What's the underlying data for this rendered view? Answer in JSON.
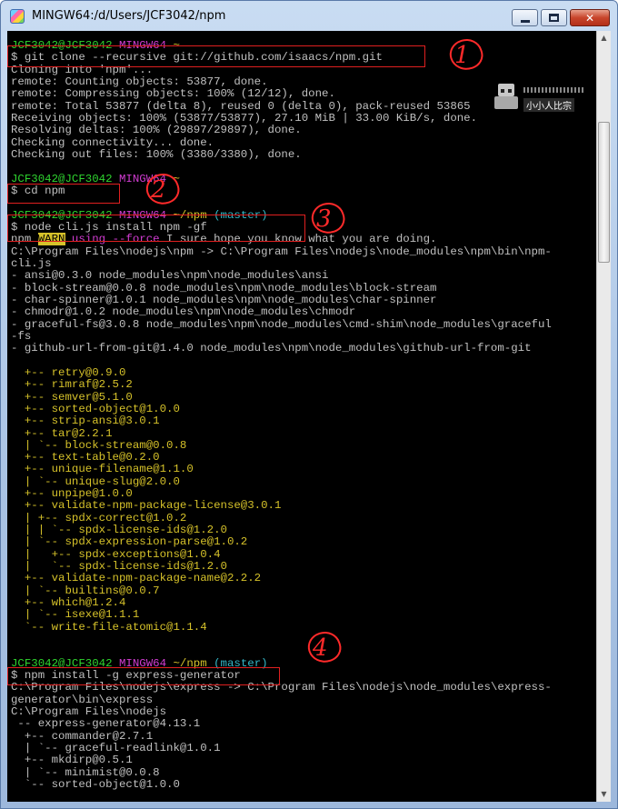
{
  "window": {
    "title": "MINGW64:/d/Users/JCF3042/npm",
    "controls": {
      "minimize": "minimize-button",
      "maximize": "maximize-button",
      "close": "close-button"
    }
  },
  "watermark": {
    "text": "小小人比宗"
  },
  "annotations": [
    "1",
    "2",
    "3",
    "4"
  ],
  "terminal": {
    "lines": [
      [
        [
          "JCF3042@JCF3042 ",
          "user"
        ],
        [
          "MINGW64 ",
          "host"
        ],
        [
          "~",
          "path"
        ]
      ],
      [
        [
          "$ git clone --recursive git://github.com/isaacs/npm.git",
          ""
        ]
      ],
      [
        [
          "Cloning into 'npm'...",
          ""
        ]
      ],
      [
        [
          "remote: Counting objects: 53877, done.",
          ""
        ]
      ],
      [
        [
          "remote: Compressing objects: 100% (12/12), done.",
          ""
        ]
      ],
      [
        [
          "remote: Total 53877 (delta 8), reused 0 (delta 0), pack-reused 53865",
          ""
        ]
      ],
      [
        [
          "Receiving objects: 100% (53877/53877), 27.10 MiB | 33.00 KiB/s, done.",
          ""
        ]
      ],
      [
        [
          "Resolving deltas: 100% (29897/29897), done.",
          ""
        ]
      ],
      [
        [
          "Checking connectivity... done.",
          ""
        ]
      ],
      [
        [
          "Checking out files: 100% (3380/3380), done.",
          ""
        ]
      ],
      [
        [
          "",
          ""
        ]
      ],
      [
        [
          "JCF3042@JCF3042 ",
          "user"
        ],
        [
          "MINGW64 ",
          "host"
        ],
        [
          "~",
          "path"
        ]
      ],
      [
        [
          "$ cd npm",
          ""
        ]
      ],
      [
        [
          "",
          ""
        ]
      ],
      [
        [
          "JCF3042@JCF3042 ",
          "user"
        ],
        [
          "MINGW64 ",
          "host"
        ],
        [
          "~/npm ",
          "path"
        ],
        [
          "(master)",
          "branch"
        ]
      ],
      [
        [
          "$ node cli.js install npm -gf",
          ""
        ]
      ],
      [
        [
          "npm ",
          ""
        ],
        [
          "WARN",
          "warn"
        ],
        [
          " using ",
          "force"
        ],
        [
          "--force",
          "force"
        ],
        [
          " I sure hope you know what you are doing.",
          ""
        ]
      ],
      [
        [
          "C:\\Program Files\\nodejs\\npm -> C:\\Program Files\\nodejs\\node_modules\\npm\\bin\\npm-",
          ""
        ]
      ],
      [
        [
          "cli.js",
          ""
        ]
      ],
      [
        [
          "- ansi@0.3.0 node_modules\\npm\\node_modules\\ansi",
          ""
        ]
      ],
      [
        [
          "- block-stream@0.0.8 node_modules\\npm\\node_modules\\block-stream",
          ""
        ]
      ],
      [
        [
          "- char-spinner@1.0.1 node_modules\\npm\\node_modules\\char-spinner",
          ""
        ]
      ],
      [
        [
          "- chmodr@1.0.2 node_modules\\npm\\node_modules\\chmodr",
          ""
        ]
      ],
      [
        [
          "- graceful-fs@3.0.8 node_modules\\npm\\node_modules\\cmd-shim\\node_modules\\graceful",
          ""
        ]
      ],
      [
        [
          "-fs",
          ""
        ]
      ],
      [
        [
          "- github-url-from-git@1.4.0 node_modules\\npm\\node_modules\\github-url-from-git",
          ""
        ]
      ],
      [
        [
          "",
          ""
        ]
      ],
      [
        [
          "  +-- retry@0.9.0",
          "tree"
        ]
      ],
      [
        [
          "  +-- rimraf@2.5.2",
          "tree"
        ]
      ],
      [
        [
          "  +-- semver@5.1.0",
          "tree"
        ]
      ],
      [
        [
          "  +-- sorted-object@1.0.0",
          "tree"
        ]
      ],
      [
        [
          "  +-- strip-ansi@3.0.1",
          "tree"
        ]
      ],
      [
        [
          "  +-- tar@2.2.1",
          "tree"
        ]
      ],
      [
        [
          "  | `-- block-stream@0.0.8",
          "tree"
        ]
      ],
      [
        [
          "  +-- text-table@0.2.0",
          "tree"
        ]
      ],
      [
        [
          "  +-- unique-filename@1.1.0",
          "tree"
        ]
      ],
      [
        [
          "  | `-- unique-slug@2.0.0",
          "tree"
        ]
      ],
      [
        [
          "  +-- unpipe@1.0.0",
          "tree"
        ]
      ],
      [
        [
          "  +-- validate-npm-package-license@3.0.1",
          "tree"
        ]
      ],
      [
        [
          "  | +-- spdx-correct@1.0.2",
          "tree"
        ]
      ],
      [
        [
          "  | | `-- spdx-license-ids@1.2.0",
          "tree"
        ]
      ],
      [
        [
          "  | `-- spdx-expression-parse@1.0.2",
          "tree"
        ]
      ],
      [
        [
          "  |   +-- spdx-exceptions@1.0.4",
          "tree"
        ]
      ],
      [
        [
          "  |   `-- spdx-license-ids@1.2.0",
          "tree"
        ]
      ],
      [
        [
          "  +-- validate-npm-package-name@2.2.2",
          "tree"
        ]
      ],
      [
        [
          "  | `-- builtins@0.0.7",
          "tree"
        ]
      ],
      [
        [
          "  +-- which@1.2.4",
          "tree"
        ]
      ],
      [
        [
          "  | `-- isexe@1.1.1",
          "tree"
        ]
      ],
      [
        [
          "  `-- write-file-atomic@1.1.4",
          "tree"
        ]
      ],
      [
        [
          "",
          ""
        ]
      ],
      [
        [
          "",
          ""
        ]
      ],
      [
        [
          "JCF3042@JCF3042 ",
          "user"
        ],
        [
          "MINGW64 ",
          "host"
        ],
        [
          "~/npm ",
          "path"
        ],
        [
          "(master)",
          "branch"
        ]
      ],
      [
        [
          "$ npm install -g express-generator",
          ""
        ]
      ],
      [
        [
          "C:\\Program Files\\nodejs\\express -> C:\\Program Files\\nodejs\\node_modules\\express-",
          ""
        ]
      ],
      [
        [
          "generator\\bin\\express",
          ""
        ]
      ],
      [
        [
          "C:\\Program Files\\nodejs",
          ""
        ]
      ],
      [
        [
          " -- express-generator@4.13.1",
          ""
        ]
      ],
      [
        [
          "  +-- commander@2.7.1",
          ""
        ]
      ],
      [
        [
          "  | `-- graceful-readlink@1.0.1",
          ""
        ]
      ],
      [
        [
          "  +-- mkdirp@0.5.1",
          ""
        ]
      ],
      [
        [
          "  | `-- minimist@0.0.8",
          ""
        ]
      ],
      [
        [
          "  `-- sorted-object@1.0.0",
          ""
        ]
      ]
    ]
  }
}
